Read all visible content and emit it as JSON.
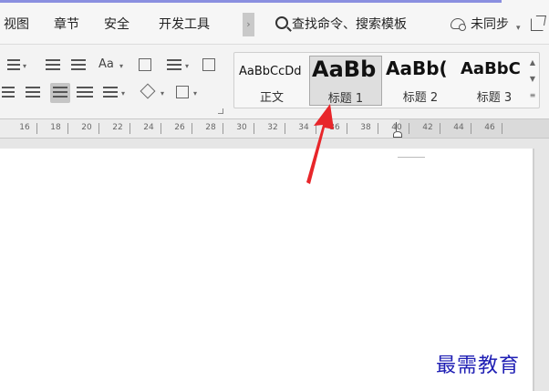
{
  "menu": {
    "items": [
      "视图",
      "章节",
      "安全",
      "开发工具"
    ],
    "more": "›",
    "search_label": "查找命令、搜索模板",
    "sync_label": "未同步",
    "sync_dropdown": "▾"
  },
  "ribbon": {
    "font_case": "Aa",
    "dropdown": "▾"
  },
  "styles": [
    {
      "sample": "AaBbCcDd",
      "name": "正文"
    },
    {
      "sample": "AaBb",
      "name": "标题 1"
    },
    {
      "sample": "AaBb(",
      "name": "标题 2"
    },
    {
      "sample": "AaBbC",
      "name": "标题 3"
    }
  ],
  "ruler": {
    "labels": [
      "16",
      "18",
      "20",
      "22",
      "24",
      "26",
      "28",
      "30",
      "32",
      "34",
      "36",
      "38",
      "40",
      "42",
      "44",
      "46"
    ]
  },
  "watermark": "最需教育",
  "colors": {
    "accent_line": "#8a8fe0",
    "watermark": "#1f1fb4",
    "arrow": "#e8262a"
  }
}
